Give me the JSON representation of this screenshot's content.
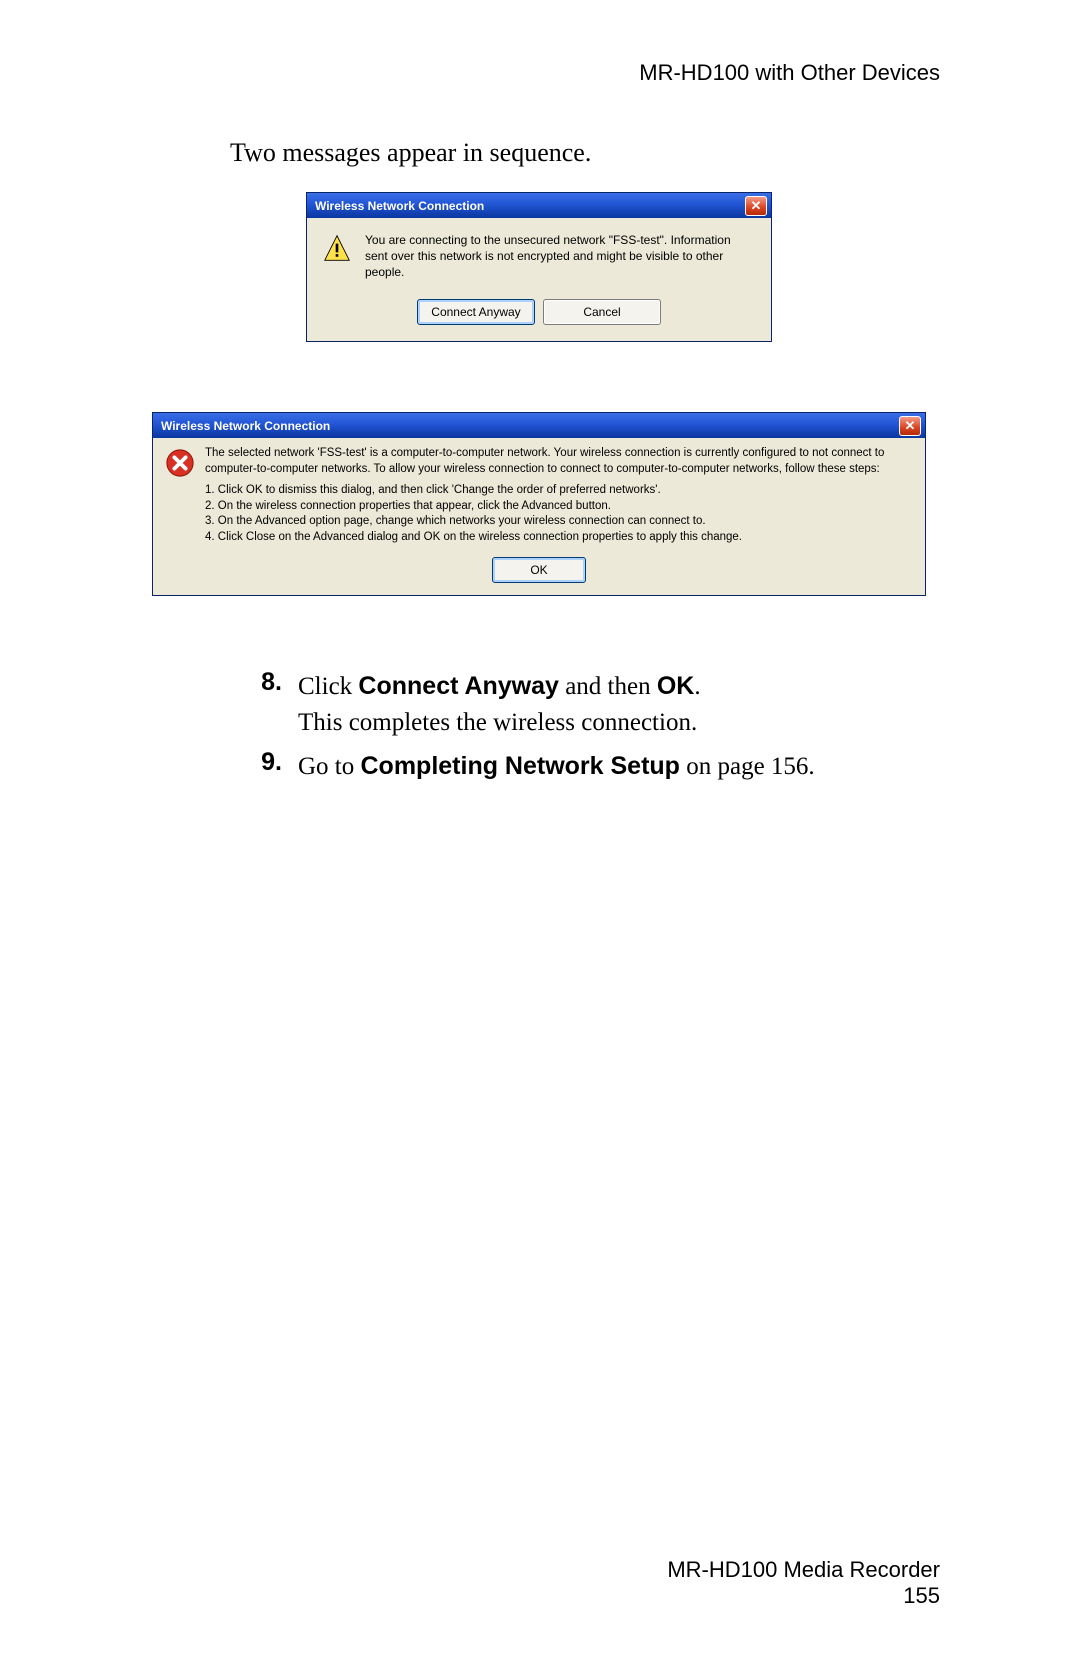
{
  "header": "MR-HD100 with Other Devices",
  "intro": "Two messages appear in sequence.",
  "dialog1": {
    "title": "Wireless Network Connection",
    "close_glyph": "✕",
    "message": "You are connecting to the unsecured network \"FSS-test\". Information sent over this network is not encrypted and might be visible to other people.",
    "buttons": {
      "connect": "Connect Anyway",
      "cancel": "Cancel"
    }
  },
  "dialog2": {
    "title": "Wireless Network Connection",
    "close_glyph": "✕",
    "paragraph": "The selected network 'FSS-test' is a computer-to-computer network. Your wireless connection is currently configured to not connect to computer-to-computer networks. To allow your wireless connection to connect to computer-to-computer networks, follow these steps:",
    "steps": [
      "1. Click OK to dismiss this dialog, and then click 'Change the order of preferred networks'.",
      "2. On the wireless connection properties that appear, click the Advanced button.",
      "3. On the Advanced option page, change which networks your wireless connection can connect to.",
      "4. Click Close on the Advanced dialog and OK on the wireless connection properties to apply this change."
    ],
    "buttons": {
      "ok": "OK"
    }
  },
  "list": {
    "items": [
      {
        "num": "8.",
        "parts": [
          {
            "t": "Click ",
            "b": false
          },
          {
            "t": "Connect Anyway",
            "b": true
          },
          {
            "t": " and then ",
            "b": false
          },
          {
            "t": "OK",
            "b": true
          },
          {
            "t": ".",
            "b": false
          }
        ],
        "line2": "This completes the wireless connection."
      },
      {
        "num": "9.",
        "parts": [
          {
            "t": "Go to ",
            "b": false
          },
          {
            "t": "Completing Network Setup",
            "b": true
          },
          {
            "t": " on page 156.",
            "b": false
          }
        ]
      }
    ]
  },
  "footer": {
    "line1": "MR-HD100 Media Recorder",
    "line2": "155"
  }
}
